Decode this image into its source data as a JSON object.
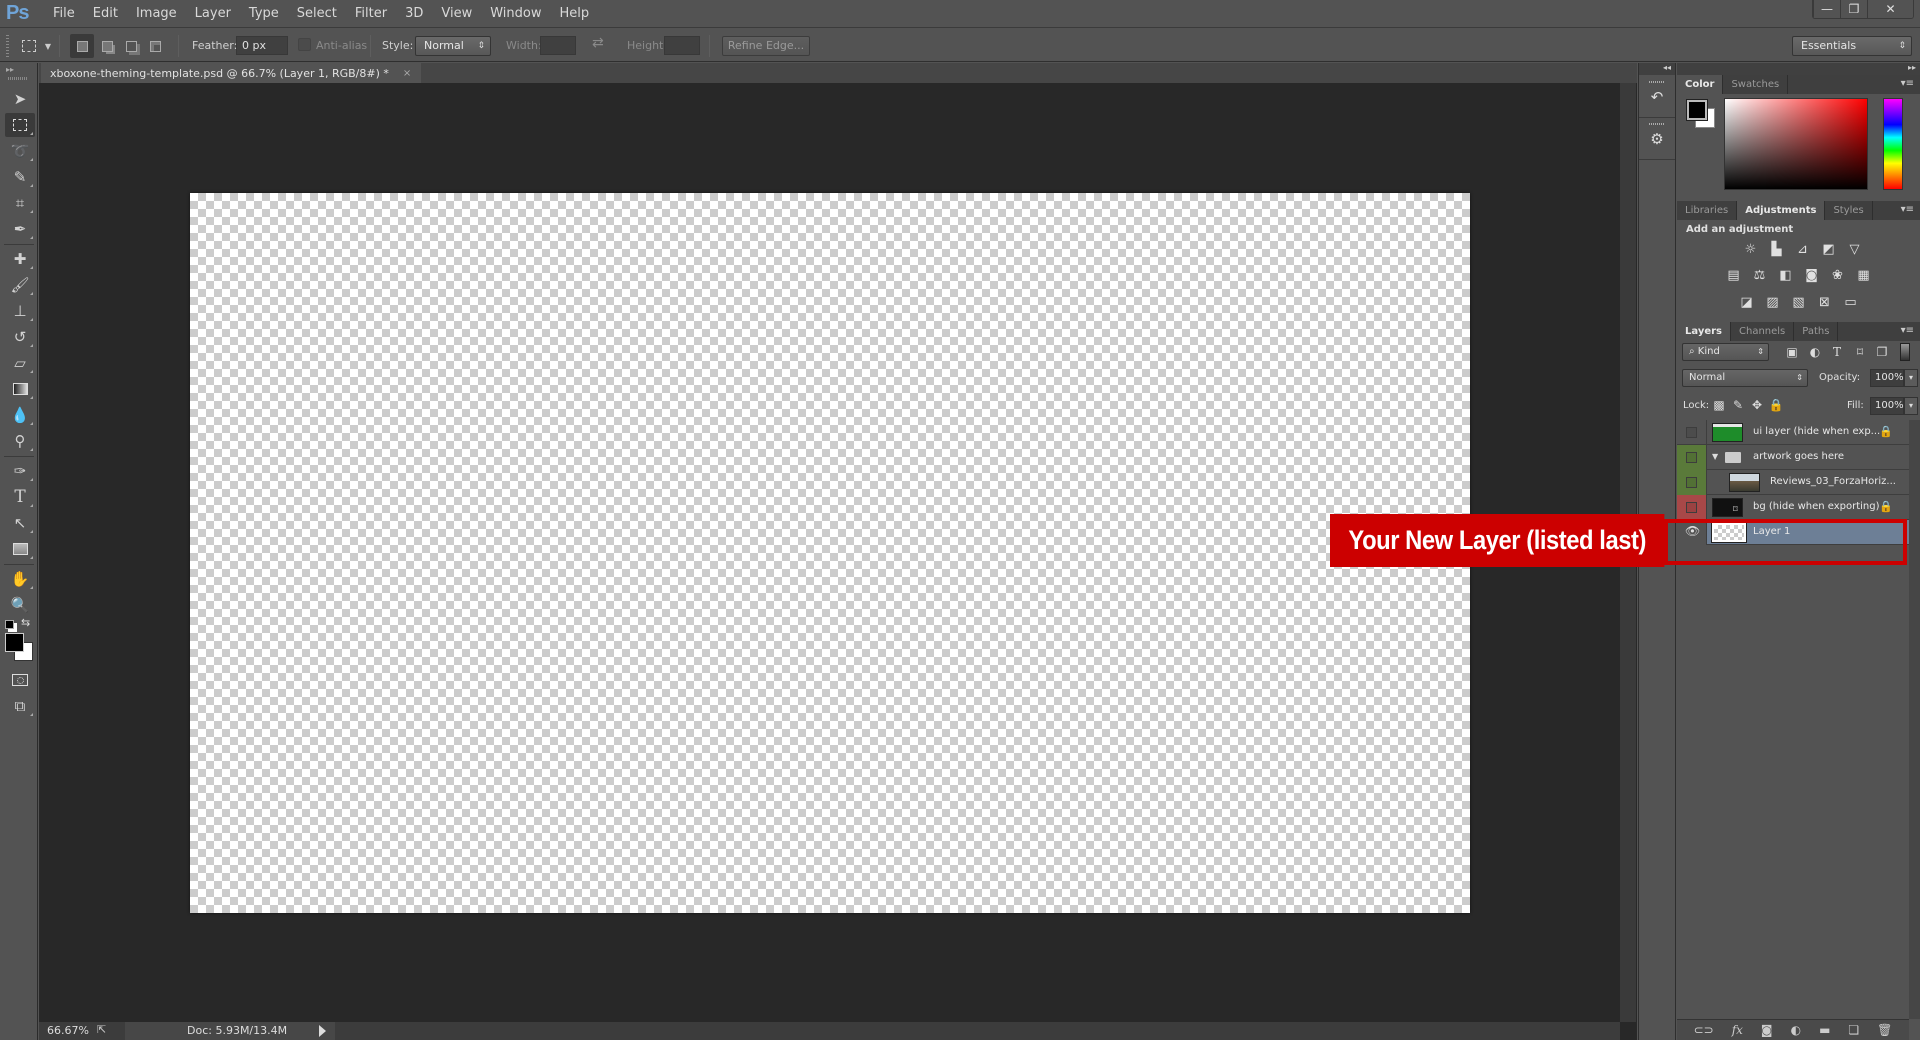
{
  "app": {
    "logo": "Ps"
  },
  "menubar": {
    "items": [
      "File",
      "Edit",
      "Image",
      "Layer",
      "Type",
      "Select",
      "Filter",
      "3D",
      "View",
      "Window",
      "Help"
    ]
  },
  "window_controls": {
    "minimize": "—",
    "restore": "❐",
    "close": "✕"
  },
  "options_bar": {
    "feather_label": "Feather:",
    "feather_value": "0 px",
    "antialias_label": "Anti-alias",
    "antialias_checked": false,
    "style_label": "Style:",
    "style_value": "Normal",
    "width_label": "Width:",
    "width_value": "",
    "height_label": "Height:",
    "height_value": "",
    "refine_edge_label": "Refine Edge...",
    "workspace_value": "Essentials"
  },
  "document": {
    "tab_title": "xboxone-theming-template.psd @ 66.7% (Layer 1, RGB/8#) *",
    "close_glyph": "×",
    "zoom_value": "66.67%",
    "doc_size": "Doc: 5.93M/13.4M"
  },
  "panels": {
    "color_tabs": [
      "Color",
      "Swatches"
    ],
    "color_active": "Color",
    "foreground_color": "#000000",
    "background_color": "#ffffff",
    "adjust_tabs": [
      "Libraries",
      "Adjustments",
      "Styles"
    ],
    "adjust_active": "Adjustments",
    "add_adjustment_label": "Add an adjustment",
    "layers_tabs": [
      "Layers",
      "Channels",
      "Paths"
    ],
    "layers_active": "Layers",
    "filter_kind": "Kind",
    "blend_mode": "Normal",
    "opacity_label": "Opacity:",
    "opacity_value": "100%",
    "lock_label": "Lock:",
    "fill_label": "Fill:",
    "fill_value": "100%"
  },
  "layers": [
    {
      "name": "ui layer (hide when exp...",
      "visible": false,
      "locked": true,
      "color_tag": "none"
    },
    {
      "name": "artwork goes here",
      "visible": false,
      "locked": false,
      "color_tag": "#5a7a3a",
      "group": true,
      "expanded": true
    },
    {
      "name": "Reviews_03_ForzaHoriz...",
      "visible": false,
      "locked": false,
      "color_tag": "#5a7a3a"
    },
    {
      "name": "bg (hide when exporting)",
      "visible": false,
      "locked": true,
      "color_tag": "#a84848"
    },
    {
      "name": "Layer 1",
      "visible": true,
      "locked": false,
      "selected": true,
      "color_tag": "none"
    }
  ],
  "annotation": {
    "label": "Your New Layer (listed last)",
    "color": "#cc0000"
  },
  "colors": {
    "ui_bg": "#535353",
    "pasteboard": "#282828",
    "selected_layer": "#6d7f96",
    "ps_blue": "#6fa4d8"
  }
}
